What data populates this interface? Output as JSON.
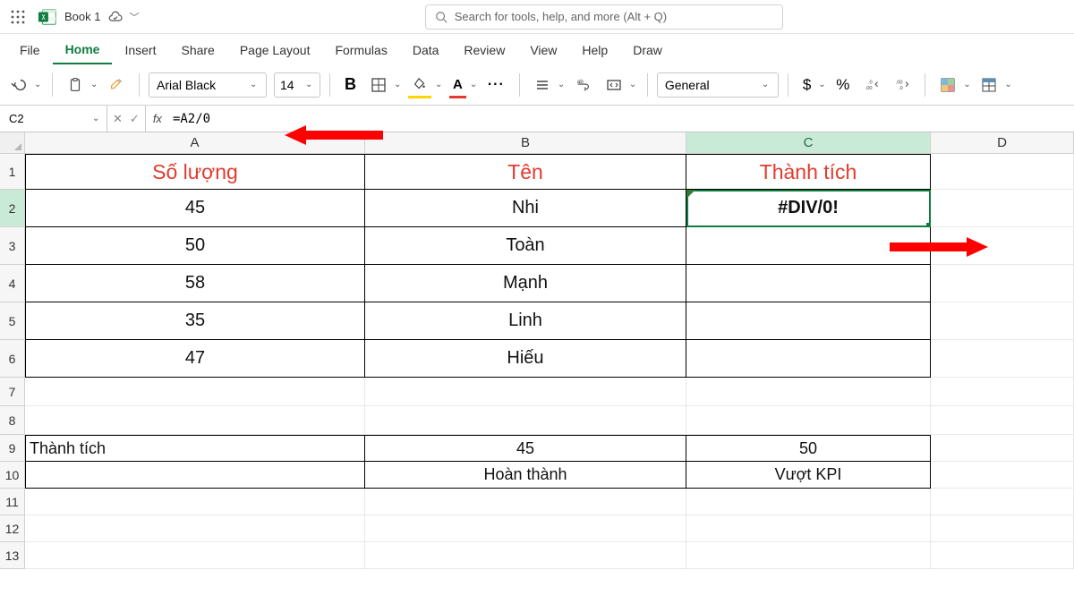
{
  "title": {
    "doc": "Book 1"
  },
  "search": {
    "placeholder": "Search for tools, help, and more (Alt + Q)"
  },
  "menu": {
    "file": "File",
    "home": "Home",
    "insert": "Insert",
    "share": "Share",
    "page_layout": "Page Layout",
    "formulas": "Formulas",
    "data": "Data",
    "review": "Review",
    "view": "View",
    "help": "Help",
    "draw": "Draw"
  },
  "ribbon": {
    "font_name": "Arial Black",
    "font_size": "14",
    "number_format": "General"
  },
  "formula_bar": {
    "name_box": "C2",
    "formula": "=A2/0"
  },
  "icons": {
    "bold": "B",
    "fontcolor": "A",
    "more": "···",
    "dollar": "$",
    "percent": "%",
    "ab": "ab"
  },
  "headers": {
    "A": "A",
    "B": "B",
    "C": "C",
    "D": "D"
  },
  "row_labels": [
    "1",
    "2",
    "3",
    "4",
    "5",
    "6",
    "7",
    "8",
    "9",
    "10",
    "11",
    "12",
    "13"
  ],
  "table": {
    "header": {
      "a": "Số lượng",
      "b": "Tên",
      "c": "Thành tích"
    },
    "rows": [
      {
        "a": "45",
        "b": "Nhi",
        "c": "#DIV/0!"
      },
      {
        "a": "50",
        "b": "Toàn",
        "c": ""
      },
      {
        "a": "58",
        "b": "Mạnh",
        "c": ""
      },
      {
        "a": "35",
        "b": "Linh",
        "c": ""
      },
      {
        "a": "47",
        "b": "Hiếu",
        "c": ""
      }
    ]
  },
  "lower": {
    "r9": {
      "a": "Thành tích",
      "b": "45",
      "c": "50"
    },
    "r10": {
      "a": "",
      "b": "Hoàn thành",
      "c": "Vượt KPI"
    }
  }
}
